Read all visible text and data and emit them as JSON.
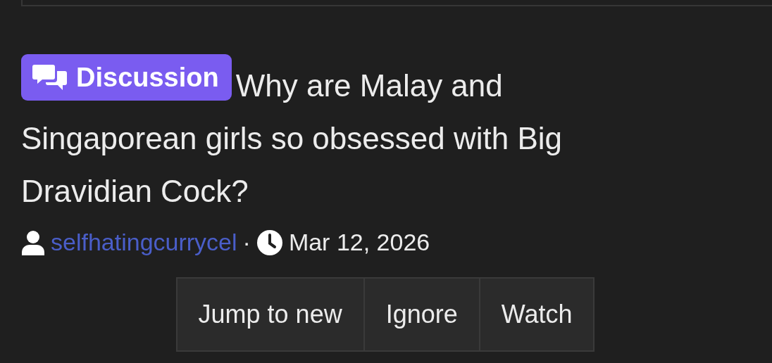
{
  "thread": {
    "prefix": "Discussion",
    "title": "Why are Malay and Singaporean girls so obsessed with Big Dravidian Cock?",
    "author": "selfhatingcurrycel",
    "separator": "·",
    "date": "Mar 12, 2026"
  },
  "buttons": [
    "Jump to new",
    "Ignore",
    "Watch"
  ]
}
